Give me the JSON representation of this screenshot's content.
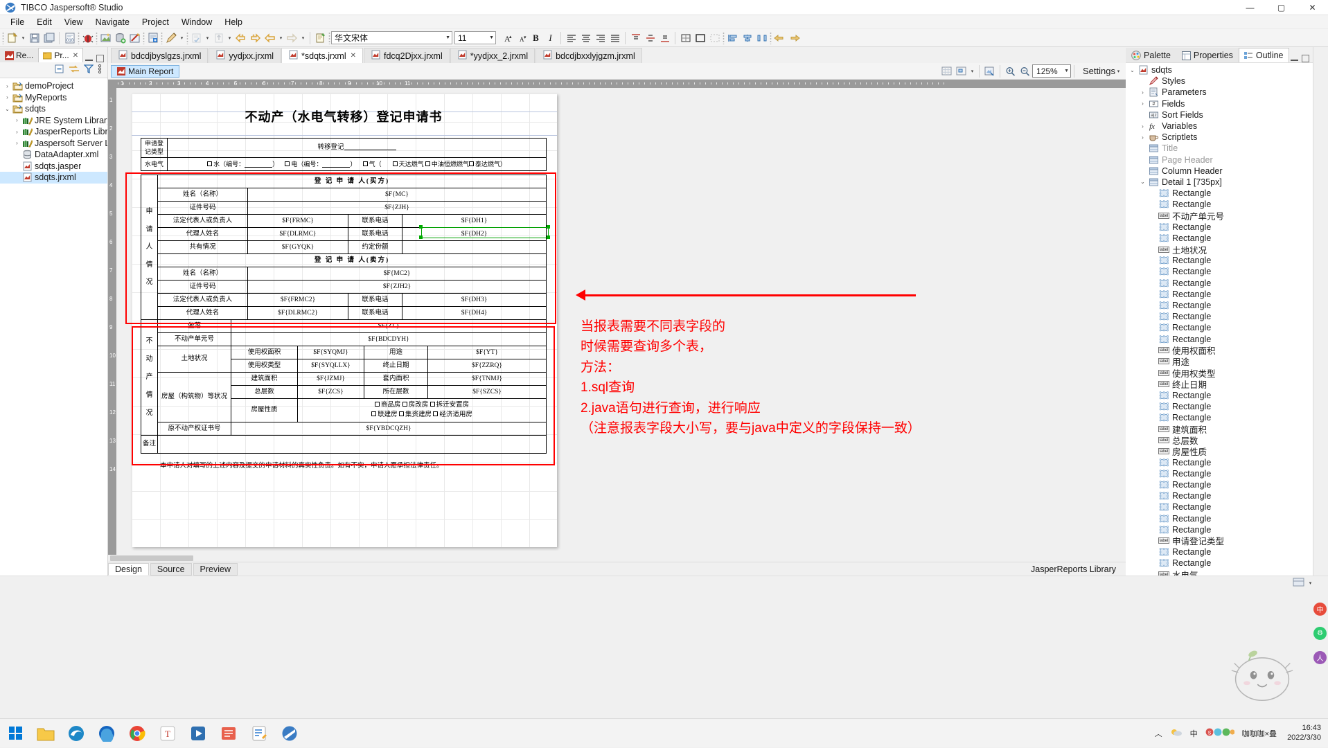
{
  "window": {
    "title": "TIBCO Jaspersoft® Studio",
    "app_icon": "jaspersoft-icon",
    "minimize": "—",
    "maximize": "▢",
    "close": "✕"
  },
  "menu": [
    "File",
    "Edit",
    "View",
    "Navigate",
    "Project",
    "Window",
    "Help"
  ],
  "toolbar": {
    "font_family": "华文宋体",
    "font_size": "11",
    "increase_font": "A",
    "decrease_font": "A",
    "bold": "B",
    "italic": "I"
  },
  "left_panel": {
    "tabs": [
      {
        "label": "Re...",
        "icon": "report-icon",
        "active": false
      },
      {
        "label": "Pr...",
        "icon": "project-explorer-icon",
        "active": true
      }
    ],
    "tree": [
      {
        "label": "demoProject",
        "depth": 0,
        "arrow": "collapsed",
        "icon": "project-folder-icon",
        "selected": false
      },
      {
        "label": "MyReports",
        "depth": 0,
        "arrow": "collapsed",
        "icon": "project-folder-icon",
        "selected": false
      },
      {
        "label": "sdqts",
        "depth": 0,
        "arrow": "expanded",
        "icon": "project-folder-icon",
        "selected": false
      },
      {
        "label": "JRE System Library [Jav",
        "depth": 1,
        "arrow": "collapsed",
        "icon": "library-icon",
        "selected": false
      },
      {
        "label": "JasperReports Library",
        "depth": 1,
        "arrow": "collapsed",
        "icon": "library-icon",
        "selected": false
      },
      {
        "label": "Jaspersoft Server Libra",
        "depth": 1,
        "arrow": "collapsed",
        "icon": "library-icon",
        "selected": false
      },
      {
        "label": "DataAdapter.xml",
        "depth": 1,
        "arrow": "none",
        "icon": "xml-data-icon",
        "selected": false
      },
      {
        "label": "sdqts.jasper",
        "depth": 1,
        "arrow": "none",
        "icon": "jasper-icon",
        "selected": false
      },
      {
        "label": "sdqts.jrxml",
        "depth": 1,
        "arrow": "none",
        "icon": "jrxml-icon",
        "selected": true
      }
    ]
  },
  "editor": {
    "tabs": [
      {
        "label": "bdcdjbyslgzs.jrxml",
        "active": false,
        "closable": false
      },
      {
        "label": "yydjxx.jrxml",
        "active": false,
        "closable": false
      },
      {
        "label": "*sdqts.jrxml",
        "active": true,
        "closable": true
      },
      {
        "label": "fdcq2Djxx.jrxml",
        "active": false,
        "closable": false
      },
      {
        "label": "*yydjxx_2.jrxml",
        "active": false,
        "closable": false
      },
      {
        "label": "bdcdjbxxlyjgzm.jrxml",
        "active": false,
        "closable": false
      }
    ],
    "main_report_tab": "Main Report",
    "zoom_level": "125%",
    "settings_label": "Settings",
    "design_tabs": [
      "Design",
      "Source",
      "Preview"
    ],
    "status_right": "JasperReports Library",
    "ruler_ticks": [
      "1",
      "2",
      "3",
      "4",
      "5",
      "6",
      "7",
      "8",
      "9",
      "10",
      "11"
    ]
  },
  "report": {
    "title": "不动产（水电气转移）登记申请书",
    "head_rows": {
      "apply_type_label": "申请登\n记类型",
      "apply_type_value": "转移登记",
      "utility_label": "水电气",
      "utility_options": [
        "水（编号：",
        "电（编号：",
        "气（",
        "天达燃气",
        "中油恒燃燃气",
        "泰达燃气）"
      ]
    },
    "applicant_section": {
      "vertical_label": [
        "申",
        "请",
        "人",
        "情",
        "况"
      ],
      "buyer_header": "登 记 申 请 人(买方)",
      "seller_header": "登 记 申 请 人(卖方)",
      "buyer_rows": [
        {
          "label": "姓名（名称）",
          "value": "$F{MC}",
          "label2": "",
          "value2": ""
        },
        {
          "label": "证件号码",
          "value": "$F{ZJH}",
          "label2": "",
          "value2": ""
        },
        {
          "label": "法定代表人或负责人",
          "value": "$F{FRMC}",
          "label2": "联系电话",
          "value2": "$F{DH1}"
        },
        {
          "label": "代理人姓名",
          "value": "$F{DLRMC}",
          "label2": "联系电话",
          "value2": "$F{DH2}"
        },
        {
          "label": "共有情况",
          "value": "$F{GYQK}",
          "label2": "约定份额",
          "value2": ""
        }
      ],
      "seller_rows": [
        {
          "label": "姓名（名称）",
          "value": "$F{MC2}",
          "label2": "",
          "value2": ""
        },
        {
          "label": "证件号码",
          "value": "$F{ZJH2}",
          "label2": "",
          "value2": ""
        },
        {
          "label": "法定代表人或负责人",
          "value": "$F{FRMC2}",
          "label2": "联系电话",
          "value2": "$F{DH3}"
        },
        {
          "label": "代理人姓名",
          "value": "$F{DLRMC2}",
          "label2": "联系电话",
          "value2": "$F{DH4}"
        }
      ]
    },
    "property_section": {
      "vertical_label": [
        "不",
        "动",
        "产",
        "情",
        "况"
      ],
      "rows": [
        {
          "label": "坐落",
          "value": "$F{ZL}"
        },
        {
          "label": "不动产单元号",
          "value": "$F{BDCDYH}"
        }
      ],
      "land_label": "土地状况",
      "land_rows": [
        {
          "l1": "使用权面积",
          "v1": "$F{SYQMJ}",
          "l2": "用途",
          "v2": "$F{YT}"
        },
        {
          "l1": "使用权类型",
          "v1": "$F{SYQLLX}",
          "l2": "终止日期",
          "v2": "$F{ZZRQ}"
        }
      ],
      "house_label": "房屋（构筑物）等状况",
      "house_rows": [
        {
          "l1": "建筑面积",
          "v1": "$F{JZMJ}",
          "l2": "套内面积",
          "v2": "$F{TNMJ}"
        },
        {
          "l1": "总层数",
          "v1": "$F{ZCS}",
          "l2": "所在层数",
          "v2": "$F{SZCS}"
        }
      ],
      "house_nature_label": "房屋性质",
      "house_nature_options": [
        "商品房",
        "房改房",
        "拆迁安置房",
        "联建房",
        "集资建房",
        "经济适用房"
      ],
      "original_cert_label": "原不动产权证书号",
      "original_cert_value": "$F{YBDCQZH}"
    },
    "remark_label": "备注",
    "footer_text": "本申请人对填写的上述内容及提交的申请材料的真实性负责。如有不实，申请人愿承担法律责任。"
  },
  "annotation": {
    "lines": [
      "当报表需要不同表字段的",
      "时候需要查询多个表，",
      "方法：",
      "1.sql查询",
      "2.java语句进行查询，进行响应",
      "（注意报表字段大小写，要与java中定义的字段保持一致）"
    ],
    "color": "#ff0000"
  },
  "right_panel": {
    "tabs": [
      {
        "label": "Palette",
        "icon": "palette-icon",
        "active": false
      },
      {
        "label": "Properties",
        "icon": "properties-icon",
        "active": false
      },
      {
        "label": "Outline",
        "icon": "outline-icon",
        "active": true
      }
    ],
    "outline": [
      {
        "label": "sdqts",
        "depth": 0,
        "arrow": "expanded",
        "icon": "report-icon",
        "dim": false
      },
      {
        "label": "Styles",
        "depth": 1,
        "arrow": "none",
        "icon": "styles-icon",
        "dim": false
      },
      {
        "label": "Parameters",
        "depth": 1,
        "arrow": "collapsed",
        "icon": "parameters-icon",
        "dim": false
      },
      {
        "label": "Fields",
        "depth": 1,
        "arrow": "collapsed",
        "icon": "fields-icon",
        "dim": false
      },
      {
        "label": "Sort Fields",
        "depth": 1,
        "arrow": "none",
        "icon": "sort-fields-icon",
        "dim": false
      },
      {
        "label": "Variables",
        "depth": 1,
        "arrow": "collapsed",
        "icon": "variables-icon",
        "dim": false
      },
      {
        "label": "Scriptlets",
        "depth": 1,
        "arrow": "collapsed",
        "icon": "scriptlets-icon",
        "dim": false
      },
      {
        "label": "Title",
        "depth": 1,
        "arrow": "none",
        "icon": "band-icon",
        "dim": true
      },
      {
        "label": "Page Header",
        "depth": 1,
        "arrow": "none",
        "icon": "band-icon",
        "dim": true
      },
      {
        "label": "Column Header",
        "depth": 1,
        "arrow": "none",
        "icon": "band-icon",
        "dim": false
      },
      {
        "label": "Detail 1 [735px]",
        "depth": 1,
        "arrow": "expanded",
        "icon": "band-icon",
        "dim": false
      },
      {
        "label": "Rectangle",
        "depth": 2,
        "arrow": "none",
        "icon": "rectangle-icon",
        "dim": false
      },
      {
        "label": "Rectangle",
        "depth": 2,
        "arrow": "none",
        "icon": "rectangle-icon",
        "dim": false
      },
      {
        "label": "不动产单元号",
        "depth": 2,
        "arrow": "none",
        "icon": "label-icon",
        "dim": false
      },
      {
        "label": "Rectangle",
        "depth": 2,
        "arrow": "none",
        "icon": "rectangle-icon",
        "dim": false
      },
      {
        "label": "Rectangle",
        "depth": 2,
        "arrow": "none",
        "icon": "rectangle-icon",
        "dim": false
      },
      {
        "label": "土地状况",
        "depth": 2,
        "arrow": "none",
        "icon": "label-icon",
        "dim": false
      },
      {
        "label": "Rectangle",
        "depth": 2,
        "arrow": "none",
        "icon": "rectangle-icon",
        "dim": false
      },
      {
        "label": "Rectangle",
        "depth": 2,
        "arrow": "none",
        "icon": "rectangle-icon",
        "dim": false
      },
      {
        "label": "Rectangle",
        "depth": 2,
        "arrow": "none",
        "icon": "rectangle-icon",
        "dim": false
      },
      {
        "label": "Rectangle",
        "depth": 2,
        "arrow": "none",
        "icon": "rectangle-icon",
        "dim": false
      },
      {
        "label": "Rectangle",
        "depth": 2,
        "arrow": "none",
        "icon": "rectangle-icon",
        "dim": false
      },
      {
        "label": "Rectangle",
        "depth": 2,
        "arrow": "none",
        "icon": "rectangle-icon",
        "dim": false
      },
      {
        "label": "Rectangle",
        "depth": 2,
        "arrow": "none",
        "icon": "rectangle-icon",
        "dim": false
      },
      {
        "label": "Rectangle",
        "depth": 2,
        "arrow": "none",
        "icon": "rectangle-icon",
        "dim": false
      },
      {
        "label": "使用权面积",
        "depth": 2,
        "arrow": "none",
        "icon": "label-icon",
        "dim": false
      },
      {
        "label": "用途",
        "depth": 2,
        "arrow": "none",
        "icon": "label-icon",
        "dim": false
      },
      {
        "label": "使用权类型",
        "depth": 2,
        "arrow": "none",
        "icon": "label-icon",
        "dim": false
      },
      {
        "label": "终止日期",
        "depth": 2,
        "arrow": "none",
        "icon": "label-icon",
        "dim": false
      },
      {
        "label": "Rectangle",
        "depth": 2,
        "arrow": "none",
        "icon": "rectangle-icon",
        "dim": false
      },
      {
        "label": "Rectangle",
        "depth": 2,
        "arrow": "none",
        "icon": "rectangle-icon",
        "dim": false
      },
      {
        "label": "Rectangle",
        "depth": 2,
        "arrow": "none",
        "icon": "rectangle-icon",
        "dim": false
      },
      {
        "label": "建筑面积",
        "depth": 2,
        "arrow": "none",
        "icon": "label-icon",
        "dim": false
      },
      {
        "label": "总层数",
        "depth": 2,
        "arrow": "none",
        "icon": "label-icon",
        "dim": false
      },
      {
        "label": "房屋性质",
        "depth": 2,
        "arrow": "none",
        "icon": "label-icon",
        "dim": false
      },
      {
        "label": "Rectangle",
        "depth": 2,
        "arrow": "none",
        "icon": "rectangle-icon",
        "dim": false
      },
      {
        "label": "Rectangle",
        "depth": 2,
        "arrow": "none",
        "icon": "rectangle-icon",
        "dim": false
      },
      {
        "label": "Rectangle",
        "depth": 2,
        "arrow": "none",
        "icon": "rectangle-icon",
        "dim": false
      },
      {
        "label": "Rectangle",
        "depth": 2,
        "arrow": "none",
        "icon": "rectangle-icon",
        "dim": false
      },
      {
        "label": "Rectangle",
        "depth": 2,
        "arrow": "none",
        "icon": "rectangle-icon",
        "dim": false
      },
      {
        "label": "Rectangle",
        "depth": 2,
        "arrow": "none",
        "icon": "rectangle-icon",
        "dim": false
      },
      {
        "label": "Rectangle",
        "depth": 2,
        "arrow": "none",
        "icon": "rectangle-icon",
        "dim": false
      },
      {
        "label": "申请登记类型",
        "depth": 2,
        "arrow": "none",
        "icon": "label-icon",
        "dim": false
      },
      {
        "label": "Rectangle",
        "depth": 2,
        "arrow": "none",
        "icon": "rectangle-icon",
        "dim": false
      },
      {
        "label": "Rectangle",
        "depth": 2,
        "arrow": "none",
        "icon": "rectangle-icon",
        "dim": false
      },
      {
        "label": "水电气",
        "depth": 2,
        "arrow": "none",
        "icon": "label-icon",
        "dim": false
      },
      {
        "label": "转移登记________",
        "depth": 2,
        "arrow": "none",
        "icon": "label-icon",
        "dim": false
      },
      {
        "label": "水（编号：           ）",
        "depth": 2,
        "arrow": "none",
        "icon": "label-icon",
        "dim": false
      }
    ]
  },
  "taskbar": {
    "start": "windows-start-icon",
    "items": [
      "file-explorer-icon",
      "edge-icon",
      "firefox-icon",
      "chrome-icon",
      "typora-icon",
      "player-icon",
      "office-icon",
      "editor-icon",
      "jaspersoft-icon"
    ],
    "tray_ime": "中",
    "time": "16:43",
    "date": "2022/3/30"
  }
}
